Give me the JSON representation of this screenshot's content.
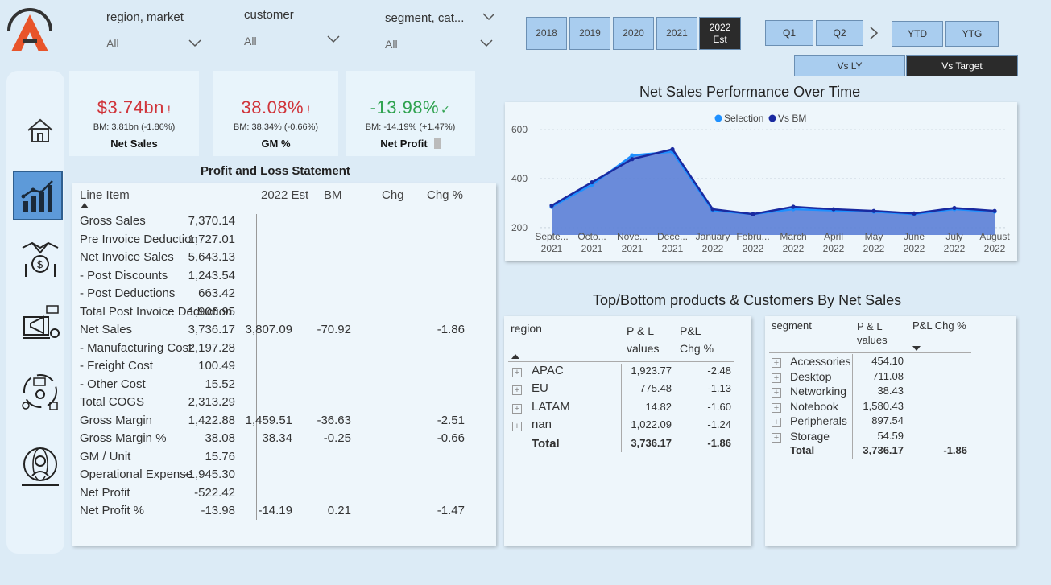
{
  "slicers": [
    {
      "title": "region, market",
      "value": "All"
    },
    {
      "title": "customer",
      "value": "All"
    },
    {
      "title": "segment, cat...",
      "value": "All"
    }
  ],
  "years": [
    "2018",
    "2019",
    "2020",
    "2021",
    "2022 Est"
  ],
  "selected_year": "2022 Est",
  "quarters": [
    "Q1",
    "Q2"
  ],
  "periods": [
    "YTD",
    "YTG"
  ],
  "compare": [
    "Vs LY",
    "Vs Target"
  ],
  "selected_compare": "Vs Target",
  "kpis": [
    {
      "value": "$3.74bn",
      "flag": "!",
      "bm": "BM: 3.81bn (-1.86%)",
      "label": "Net Sales",
      "color": "#d0343a"
    },
    {
      "value": "38.08%",
      "flag": "!",
      "bm": "BM: 38.34% (-0.66%)",
      "label": "GM %",
      "color": "#d0343a"
    },
    {
      "value": "-13.98%",
      "flag": "✓",
      "bm": "BM: -14.19% (+1.47%)",
      "label": "Net Profit",
      "color": "#2fa24f"
    }
  ],
  "pl": {
    "title": "Profit and Loss Statement",
    "headers": [
      "Line Item",
      "2022 Est",
      "BM",
      "Chg",
      "Chg %"
    ],
    "rows": [
      {
        "item": "Gross Sales",
        "est": "7,370.14",
        "bm": "",
        "chg": "",
        "chgp": ""
      },
      {
        "item": "Pre Invoice Deduction",
        "est": "1,727.01",
        "bm": "",
        "chg": "",
        "chgp": ""
      },
      {
        "item": "Net Invoice Sales",
        "est": "5,643.13",
        "bm": "",
        "chg": "",
        "chgp": ""
      },
      {
        "item": "- Post Discounts",
        "est": "1,243.54",
        "bm": "",
        "chg": "",
        "chgp": ""
      },
      {
        "item": "- Post Deductions",
        "est": "663.42",
        "bm": "",
        "chg": "",
        "chgp": ""
      },
      {
        "item": "Total Post Invoice Deduction",
        "est": "1,906.95",
        "bm": "",
        "chg": "",
        "chgp": ""
      },
      {
        "item": "Net Sales",
        "est": "3,736.17",
        "bm": "3,807.09",
        "chg": "-70.92",
        "chgp": "-1.86"
      },
      {
        "item": "- Manufacturing Cost",
        "est": "2,197.28",
        "bm": "",
        "chg": "",
        "chgp": ""
      },
      {
        "item": "- Freight Cost",
        "est": "100.49",
        "bm": "",
        "chg": "",
        "chgp": ""
      },
      {
        "item": "- Other Cost",
        "est": "15.52",
        "bm": "",
        "chg": "",
        "chgp": ""
      },
      {
        "item": "Total COGS",
        "est": "2,313.29",
        "bm": "",
        "chg": "",
        "chgp": ""
      },
      {
        "item": "Gross Margin",
        "est": "1,422.88",
        "bm": "1,459.51",
        "chg": "-36.63",
        "chgp": "-2.51"
      },
      {
        "item": "Gross Margin %",
        "est": "38.08",
        "bm": "38.34",
        "chg": "-0.25",
        "chgp": "-0.66"
      },
      {
        "item": "GM / Unit",
        "est": "15.76",
        "bm": "",
        "chg": "",
        "chgp": ""
      },
      {
        "item": "Operational Expense",
        "est": "-1,945.30",
        "bm": "",
        "chg": "",
        "chgp": ""
      },
      {
        "item": "Net Profit",
        "est": "-522.42",
        "bm": "",
        "chg": "",
        "chgp": ""
      },
      {
        "item": "Net Profit %",
        "est": "-13.98",
        "bm": "-14.19",
        "chg": "0.21",
        "chgp": "-1.47"
      }
    ]
  },
  "perf_title": "Net Sales  Performance Over Time",
  "chart_data": {
    "type": "area",
    "legend": [
      "Selection",
      "Vs BM"
    ],
    "x": [
      "Septe... 2021",
      "Octo... 2021",
      "Nove... 2021",
      "Dece... 2021",
      "January 2022",
      "Febru... 2022",
      "March 2022",
      "April 2022",
      "May 2022",
      "June 2022",
      "July 2022",
      "August 2022"
    ],
    "x_top": [
      "Septe...",
      "Octo...",
      "Nove...",
      "Dece...",
      "January",
      "Febru...",
      "March",
      "April",
      "May",
      "June",
      "July",
      "August"
    ],
    "x_bottom": [
      "2021",
      "2021",
      "2021",
      "2021",
      "2022",
      "2022",
      "2022",
      "2022",
      "2022",
      "2022",
      "2022",
      "2022"
    ],
    "series": [
      {
        "name": "Selection",
        "values": [
          285,
          375,
          495,
          510,
          270,
          255,
          275,
          270,
          265,
          255,
          275,
          265
        ],
        "color": "#1e90ff"
      },
      {
        "name": "Vs BM",
        "values": [
          290,
          385,
          480,
          520,
          275,
          255,
          285,
          275,
          268,
          258,
          280,
          268
        ],
        "color": "#1a2aa0"
      }
    ],
    "yticks": [
      200,
      400,
      600
    ],
    "ylim": [
      170,
      640
    ],
    "legend_position": "top-center",
    "grid": true
  },
  "topbottom_title": "Top/Bottom products & Customers By Net Sales",
  "region_table": {
    "headers": [
      "region",
      "P & L values",
      "P&L Chg %"
    ],
    "rows": [
      {
        "name": "APAC",
        "value": "1,923.77",
        "chg": "-2.48"
      },
      {
        "name": "EU",
        "value": "775.48",
        "chg": "-1.13"
      },
      {
        "name": "LATAM",
        "value": "14.82",
        "chg": "-1.60"
      },
      {
        "name": "nan",
        "value": "1,022.09",
        "chg": "-1.24"
      }
    ],
    "total": {
      "name": "Total",
      "value": "3,736.17",
      "chg": "-1.86"
    }
  },
  "segment_table": {
    "headers": [
      "segment",
      "P & L values",
      "P&L Chg %"
    ],
    "rows": [
      {
        "name": "Accessories",
        "value": "454.10",
        "chg": ""
      },
      {
        "name": "Desktop",
        "value": "711.08",
        "chg": ""
      },
      {
        "name": "Networking",
        "value": "38.43",
        "chg": ""
      },
      {
        "name": "Notebook",
        "value": "1,580.43",
        "chg": ""
      },
      {
        "name": "Peripherals",
        "value": "897.54",
        "chg": ""
      },
      {
        "name": "Storage",
        "value": "54.59",
        "chg": ""
      }
    ],
    "total": {
      "name": "Total",
      "value": "3,736.17",
      "chg": "-1.86"
    }
  },
  "icons": [
    "logo-icon",
    "home-icon",
    "finance-icon",
    "sales-icon",
    "marketing-icon",
    "supply-chain-icon",
    "executive-icon"
  ]
}
